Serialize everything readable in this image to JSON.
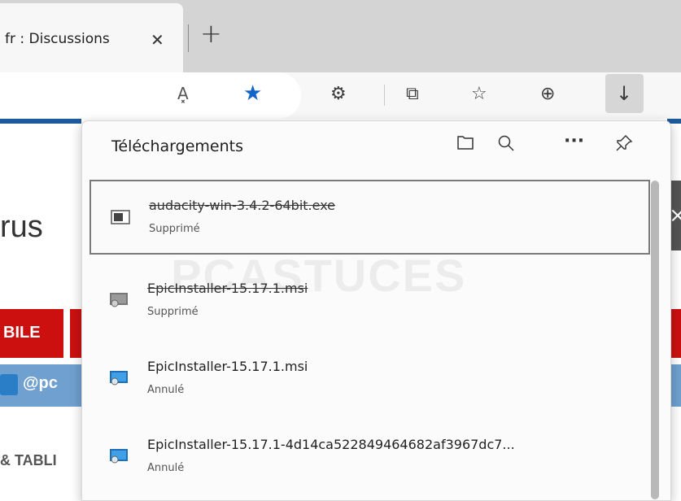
{
  "tab": {
    "title": "fr : Discussions",
    "close": "✕",
    "new": "+"
  },
  "toolbar": {
    "read_aloud": "A͓",
    "favorite": "★",
    "extensions": "⚙",
    "split": "⧉",
    "favorites": "☆",
    "collections": "⊕",
    "download": "↓"
  },
  "page": {
    "rus": "rus",
    "bile": "BILE",
    "handle": "@pc",
    "tabl": "& TABLI"
  },
  "downloads": {
    "title": "Téléchargements",
    "items": [
      {
        "name": "audacity-win-3.4.2-64bit.exe",
        "status": "Supprimé"
      },
      {
        "name": "EpicInstaller-15.17.1.msi",
        "status": "Supprimé"
      },
      {
        "name": "EpicInstaller-15.17.1.msi",
        "status": "Annulé"
      },
      {
        "name": "EpicInstaller-15.17.1-4d14ca522849464682af3967dc7...",
        "status": "Annulé"
      }
    ]
  },
  "watermark": "PCASTUCES"
}
